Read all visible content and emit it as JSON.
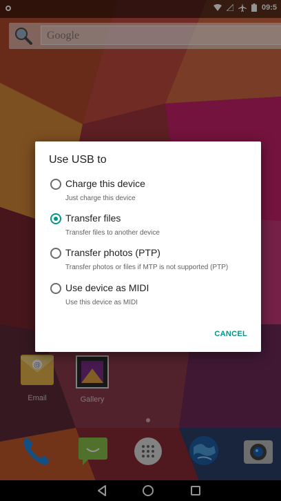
{
  "status_bar": {
    "time": "09:5"
  },
  "search": {
    "placeholder": "Google"
  },
  "dialog": {
    "title": "Use USB to",
    "options": [
      {
        "label": "Charge this device",
        "description": "Just charge this device",
        "selected": false
      },
      {
        "label": "Transfer files",
        "description": "Transfer files to another device",
        "selected": true
      },
      {
        "label": "Transfer photos (PTP)",
        "description": "Transfer photos or files if MTP is not supported (PTP)",
        "selected": false
      },
      {
        "label": "Use device as MIDI",
        "description": "Use this device as MIDI",
        "selected": false
      }
    ],
    "cancel_label": "CANCEL"
  },
  "home_apps": [
    {
      "label": "Email"
    },
    {
      "label": "Gallery"
    }
  ],
  "dock": [
    "phone-icon",
    "messaging-icon",
    "app-drawer-icon",
    "browser-icon",
    "camera-icon"
  ],
  "colors": {
    "accent": "#009688"
  }
}
